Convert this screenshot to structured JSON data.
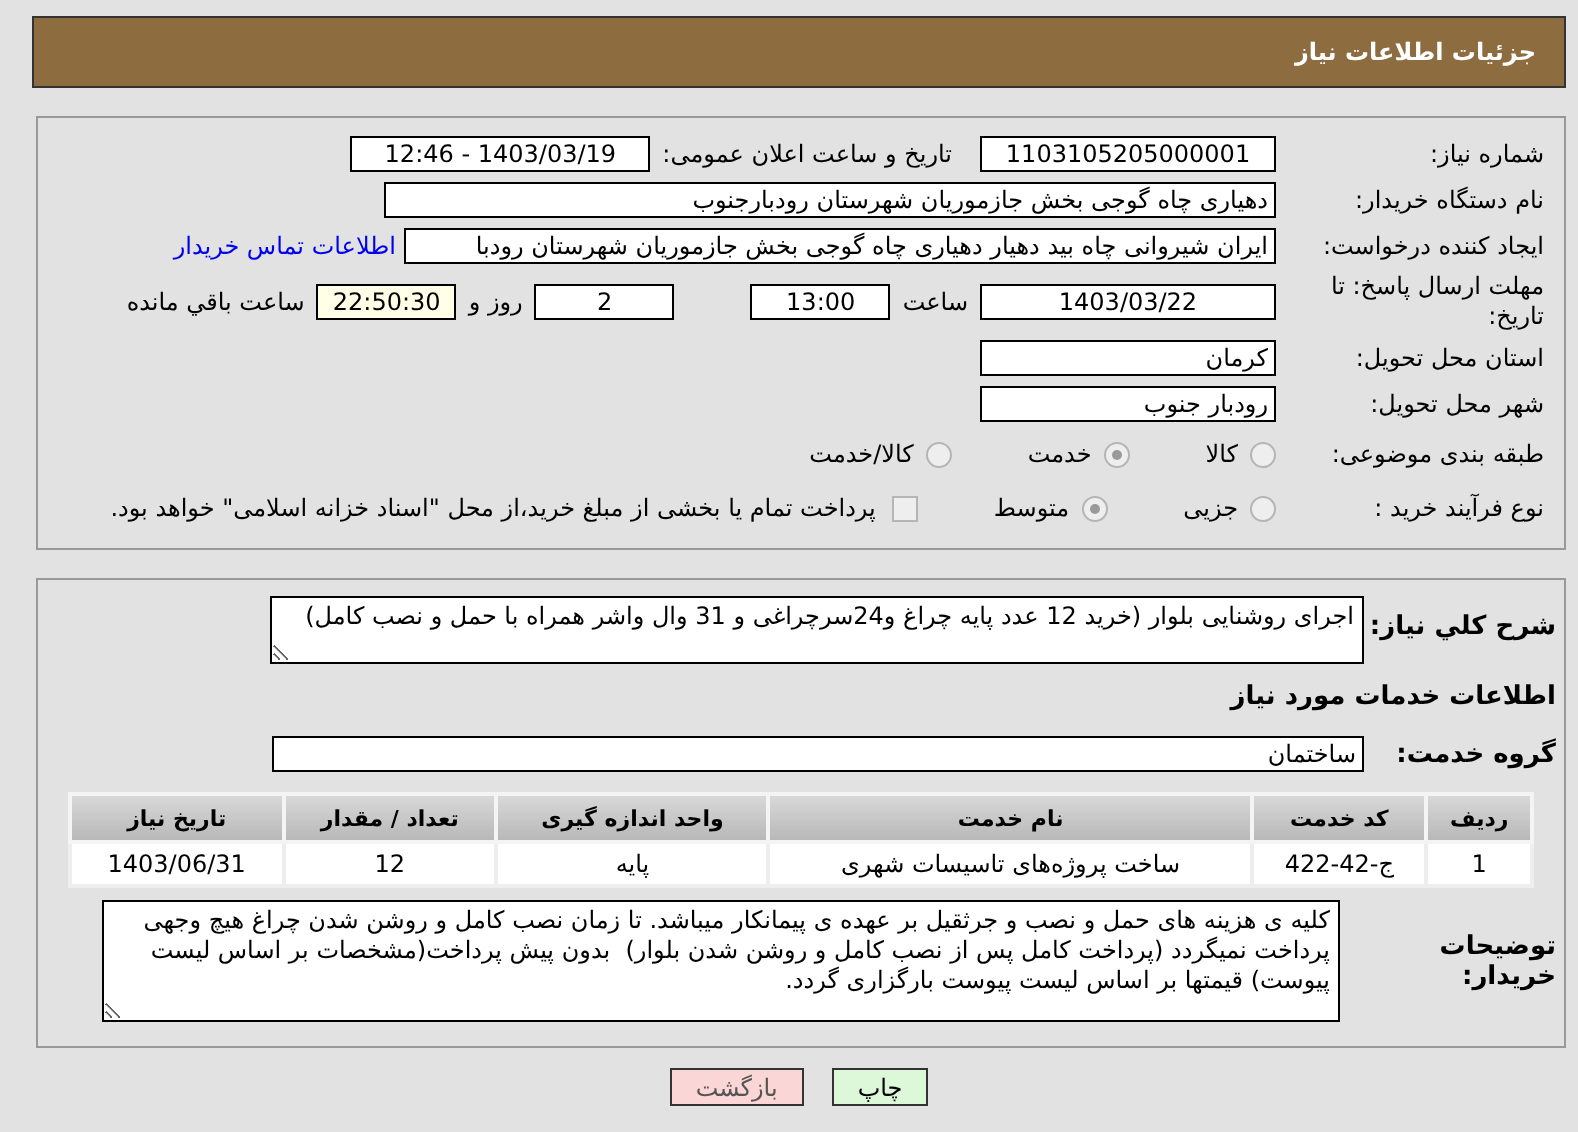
{
  "header": {
    "title": "جزئیات اطلاعات نیاز"
  },
  "need_number": {
    "label": "شماره نیاز:",
    "value": "1103105205000001"
  },
  "announce": {
    "label": "تاریخ و ساعت اعلان عمومی:",
    "value": "1403/03/19 - 12:46"
  },
  "buyer_org": {
    "label": "نام دستگاه خریدار:",
    "value": "دهیاری چاه گوجی بخش جازموریان شهرستان رودبارجنوب"
  },
  "requester": {
    "label": "ایجاد کننده درخواست:",
    "value": "ایران شیروانی چاه بید دهیار دهیاری چاه گوجی بخش جازموریان شهرستان رودبا",
    "link": "اطلاعات تماس خریدار"
  },
  "deadline": {
    "label": "مهلت ارسال پاسخ: تا تاریخ:",
    "date": "1403/03/22",
    "time_label": "ساعت",
    "time": "13:00",
    "days": "2",
    "days_label": "روز و",
    "remaining": "22:50:30",
    "remaining_label": "ساعت باقي مانده"
  },
  "province": {
    "label": "استان محل تحویل:",
    "value": "کرمان"
  },
  "city": {
    "label": "شهر محل تحویل:",
    "value": "رودبار جنوب"
  },
  "category": {
    "label": "طبقه بندی موضوعی:",
    "options": [
      {
        "label": "کالا",
        "selected": false
      },
      {
        "label": "خدمت",
        "selected": true
      },
      {
        "label": "کالا/خدمت",
        "selected": false
      }
    ]
  },
  "process": {
    "label": "نوع فرآیند خرید :",
    "options": [
      {
        "label": "جزیی",
        "selected": false
      },
      {
        "label": "متوسط",
        "selected": true
      }
    ],
    "payment": {
      "checked": false,
      "label": "پرداخت تمام یا بخشی از مبلغ خرید،از محل \"اسناد خزانه اسلامی\" خواهد بود."
    }
  },
  "description": {
    "label": "شرح کلي نياز:",
    "value": "اجرای روشنایی بلوار (خرید 12 عدد پایه چراغ و24سرچراغی و 31 وال واشر همراه با حمل و نصب کامل)"
  },
  "services_heading": "اطلاعات خدمات مورد نیاز",
  "service_group": {
    "label": "گروه خدمت:",
    "value": "ساختمان"
  },
  "table": {
    "columns": [
      "ردیف",
      "کد خدمت",
      "نام خدمت",
      "واحد اندازه گیری",
      "تعداد / مقدار",
      "تاریخ نیاز"
    ],
    "rows": [
      [
        "1",
        "ج-42-422",
        "ساخت پروژه‌های تاسیسات شهری",
        "پایه",
        "12",
        "1403/06/31"
      ]
    ]
  },
  "buyer_notes": {
    "label": "توضیحات خریدار:",
    "value": "کلیه ی هزینه های حمل و نصب و جرثقیل بر عهده ی پیمانکار میباشد. تا زمان نصب کامل و روشن شدن چراغ هیچ وجهی پرداخت نمیگردد (پرداخت کامل پس از نصب کامل و روشن شدن بلوار)  بدون پیش پرداخت(مشخصات بر اساس لیست پیوست) قیمتها بر اساس لیست پیوست بارگزاری گردد."
  },
  "buttons": [
    {
      "label": "چاپ",
      "kind": "print"
    },
    {
      "label": "بازگشت",
      "kind": "back"
    }
  ]
}
